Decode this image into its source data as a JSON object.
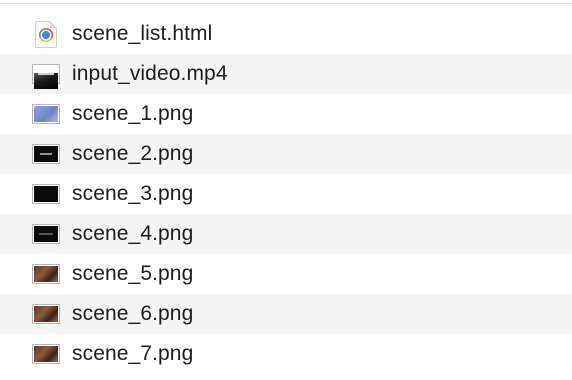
{
  "files": [
    {
      "name": "scene_list.html",
      "icon": "chrome-html-document-icon"
    },
    {
      "name": "input_video.mp4",
      "icon": "video-thumbnail-icon"
    },
    {
      "name": "scene_1.png",
      "icon": "image-thumbnail-icon"
    },
    {
      "name": "scene_2.png",
      "icon": "image-thumbnail-icon"
    },
    {
      "name": "scene_3.png",
      "icon": "image-thumbnail-icon"
    },
    {
      "name": "scene_4.png",
      "icon": "image-thumbnail-icon"
    },
    {
      "name": "scene_5.png",
      "icon": "image-thumbnail-icon"
    },
    {
      "name": "scene_6.png",
      "icon": "image-thumbnail-icon"
    },
    {
      "name": "scene_7.png",
      "icon": "image-thumbnail-icon"
    }
  ],
  "colors": {
    "text": "#1d1d1f",
    "stripe": "#f4f4f5",
    "background": "#ffffff"
  }
}
